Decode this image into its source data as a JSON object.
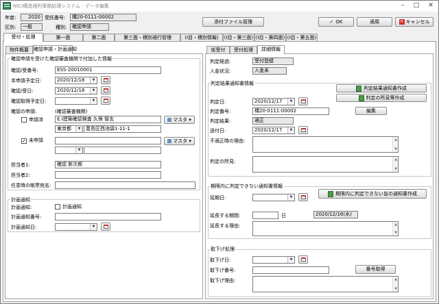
{
  "title": "NICI構造適判事務処理システム - データ編集",
  "header": {
    "year_label": "年度:",
    "year_value": "2020",
    "accept_no_label": "受託番号:",
    "accept_no_value": "構20-0111-00002",
    "category_label": "区別:",
    "category_value": "一般",
    "kind_label": "種別:",
    "kind_value": "確認申請",
    "attach_button": "添付ファイル管理",
    "ok_button": "OK",
    "apply_button": "適用",
    "cancel_button": "キャンセル"
  },
  "main_tabs": [
    "受付・処理",
    "第一面",
    "第二面",
    "第三面・積別適行管理",
    "(I目・積別情報)",
    "(I目・第三面)",
    "(I目・第四面)",
    "(I目・第五面)"
  ],
  "left": {
    "tabs": [
      "物件概要",
      "確認申請・計画通知"
    ],
    "group1_title": "確認申請を受けた確認審査機関で付加した情報",
    "confirm_no_label": "確認/受番号:",
    "confirm_no_value": "ESS-20010001",
    "plan_date_label": "本申請予定日:",
    "plan_date_value": "2020/12/18",
    "confirm_recv_label": "確認/受日:",
    "confirm_recv_value": "2020/12/18",
    "confirm_get_label": "確認取得予定日:",
    "confirm_get_value": "",
    "app_label": "確認の申請:",
    "app_org_label": "(確認審査機関)",
    "applied_label": "申請済",
    "applied_org": "E.I建築確認検査 久保 智志",
    "applied_pref": "東京都",
    "applied_addr": "豊島区西池袋1-11-1",
    "master_button": "マスタ",
    "unapplied_label": "未申請",
    "person1_label": "担当者1:",
    "person1_value": "確認 新次郎",
    "person2_label": "担当者2:",
    "person2_value": "",
    "ledger_label": "任意時の帳票宛名:",
    "ledger_value": "",
    "group2_title": "計画通知",
    "plan_notice_label": "計画通知:",
    "plan_notice_check": "計画通知",
    "plan_notice_no_label": "計画通知番号:",
    "plan_notice_no_value": "",
    "plan_notice_date_label": "計画通知日:",
    "plan_notice_date_value": ""
  },
  "right": {
    "tabs": [
      "仮受付",
      "受付処理",
      "詳細情報"
    ],
    "status_label": "判定経過:",
    "status_value": "受付登録",
    "payment_label": "入金状況:",
    "payment_value": "入金未",
    "result_group_title": "判定結果通知書情報",
    "create_notice_button": "判定結果通知書作成",
    "create_opinion_button": "判定の所見等作成",
    "judge_date_label": "判定日:",
    "judge_date_value": "2020/12/17",
    "judge_no_label": "判定番号:",
    "judge_no_value": "構20-0111-00002",
    "edit_button": "編集",
    "judge_result_label": "判定結果:",
    "judge_result_value": "適正",
    "send_date_label": "送付日:",
    "send_date_value": "2020/12/17",
    "unfit_reason_label": "不適正時の理由:",
    "opinion_label": "判定の所見:",
    "extend_group_title": "期限内に判定できない通知書情報",
    "extend_date_label": "延期日:",
    "extend_notice_button": "期限内に判定できない旨の通知書作成",
    "extend_period_label": "延長する期間:",
    "extend_period_unit": "日",
    "extend_end_value": "2020/12/16(水)",
    "extend_reason_label": "延長する理由:",
    "withdraw_group_title": "取下げ処理",
    "withdraw_date_label": "取下げ日:",
    "withdraw_no_label": "取下げ番号:",
    "get_number_button": "番号取得",
    "withdraw_reason_label": "取下げ理由:"
  },
  "colors": {
    "ok_icon": "#2e9a2e",
    "cancel_icon": "#d32f2f",
    "calendar_top": "#c0392b"
  }
}
